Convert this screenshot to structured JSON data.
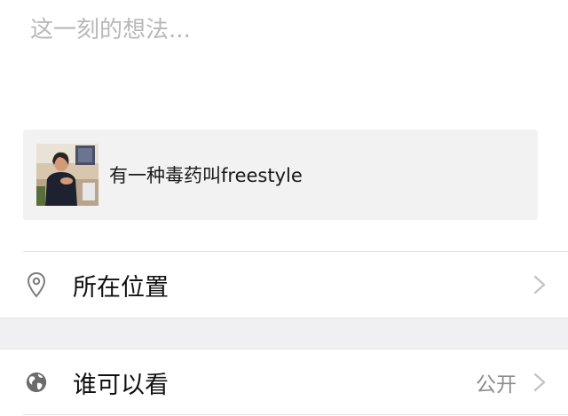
{
  "composer": {
    "placeholder": "这一刻的想法..."
  },
  "shared_link": {
    "thumbnail_icon": "photo-thumbnail",
    "title": "有一种毒药叫freestyle"
  },
  "options": {
    "location": {
      "icon": "location-pin-icon",
      "label": "所在位置"
    },
    "visibility": {
      "icon": "globe-icon",
      "label": "谁可以看",
      "value": "公开"
    }
  },
  "colors": {
    "card_background": "#f2f2f2",
    "section_gap": "#f0f0f2",
    "placeholder_text": "#b8b8b8",
    "secondary_text": "#8c8c8c"
  }
}
